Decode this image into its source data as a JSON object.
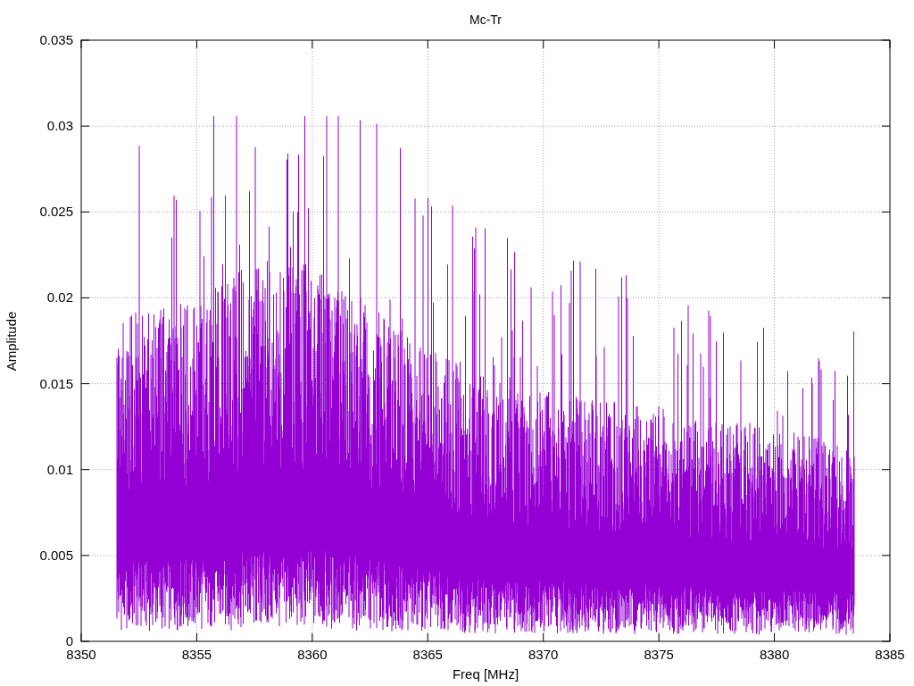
{
  "plot": {
    "title": "Mc-Tr",
    "xlabel": "Freq [MHz]",
    "ylabel": "Amplitude",
    "xticks": [
      "8350",
      "8355",
      "8360",
      "8365",
      "8370",
      "8375",
      "8380",
      "8385"
    ],
    "yticks": [
      "0.035",
      "0.03",
      "0.025",
      "0.02",
      "0.015",
      "0.01",
      "0.005",
      "0"
    ]
  }
}
